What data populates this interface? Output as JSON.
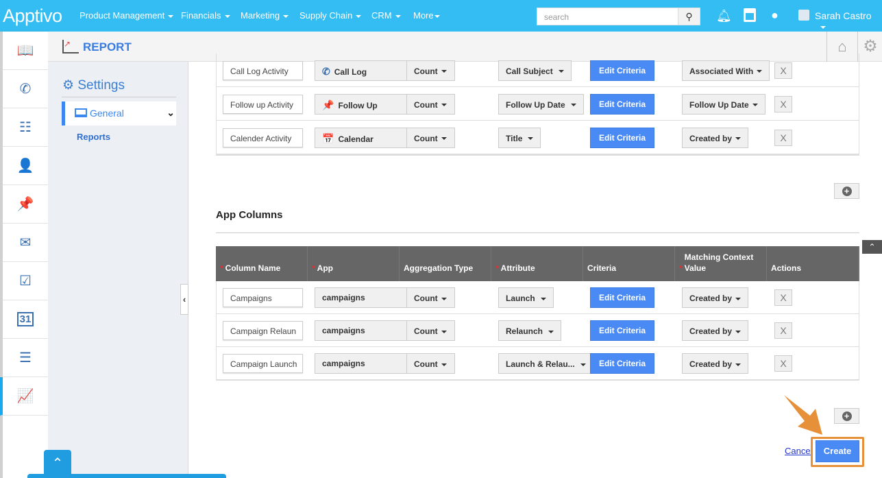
{
  "header": {
    "logo": "Apptivo",
    "nav": [
      "Product Management",
      "Financials",
      "Marketing",
      "Supply Chain",
      "CRM",
      "More"
    ],
    "search_placeholder": "search",
    "user_name": "Sarah Castro"
  },
  "sidebar_icons": [
    "book-icon",
    "call-log-icon",
    "list-icon",
    "contact-card-icon",
    "pushpin-icon",
    "mail-icon",
    "task-check-icon",
    "calendar-icon",
    "notes-icon",
    "report-chart-icon"
  ],
  "subheader": {
    "title": "REPORT"
  },
  "settings_panel": {
    "title": "Settings",
    "general": "General",
    "reports": "Reports"
  },
  "activity_rows": [
    {
      "name": "Call Log Activity",
      "app": "Call Log",
      "agg": "Count",
      "attribute": "Call Subject",
      "criteria": "Edit Criteria",
      "match": "Associated With",
      "remove": "X"
    },
    {
      "name": "Follow up Activity",
      "app": "Follow Up",
      "agg": "Count",
      "attribute": "Follow Up Date",
      "criteria": "Edit Criteria",
      "match": "Follow Up Date",
      "remove": "X"
    },
    {
      "name": "Calender Activity",
      "app": "Calendar",
      "agg": "Count",
      "attribute": "Title",
      "criteria": "Edit Criteria",
      "match": "Created by",
      "remove": "X"
    }
  ],
  "app_columns": {
    "title": "App Columns",
    "headers": [
      "Column Name",
      "App",
      "Aggregation Type",
      "Attribute",
      "Criteria",
      "Matching Context Value",
      "Actions"
    ],
    "rows": [
      {
        "name": "Campaigns",
        "app": "campaigns",
        "agg": "Count",
        "attribute": "Launch",
        "criteria": "Edit Criteria",
        "match": "Created by",
        "remove": "X"
      },
      {
        "name": "Campaign Relaun",
        "app": "campaigns",
        "agg": "Count",
        "attribute": "Relaunch",
        "criteria": "Edit Criteria",
        "match": "Created by",
        "remove": "X"
      },
      {
        "name": "Campaign Launch",
        "app": "campaigns",
        "agg": "Count",
        "attribute": "Launch & Relau...",
        "criteria": "Edit Criteria",
        "match": "Created by",
        "remove": "X"
      }
    ]
  },
  "footer": {
    "cancel": "Cancel",
    "create": "Create"
  },
  "colors": {
    "topbar": "#33bdf2",
    "primary": "#4a8af4",
    "highlight": "#e6913a"
  }
}
